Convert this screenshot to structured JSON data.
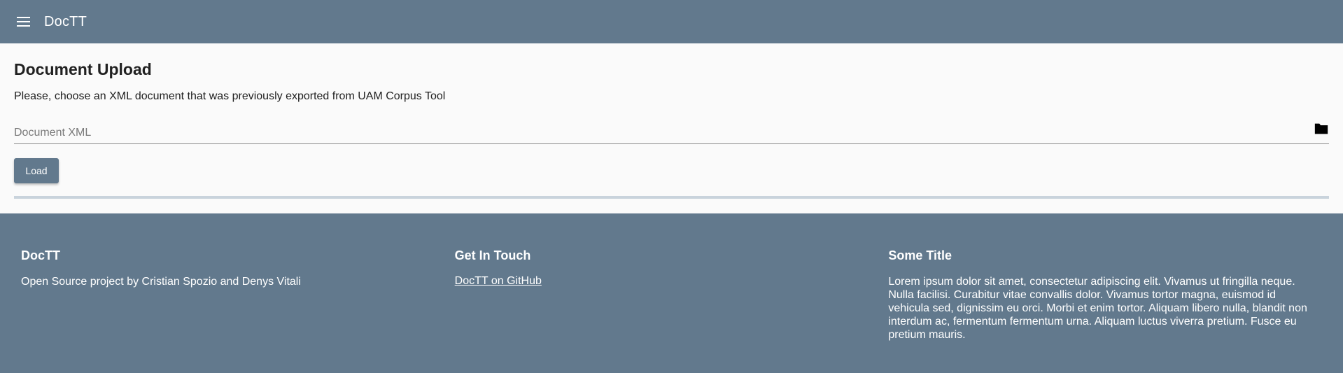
{
  "app": {
    "title": "DocTT"
  },
  "upload": {
    "title": "Document Upload",
    "instructions": "Please, choose an XML document that was previously exported from UAM Corpus Tool",
    "field_placeholder": "Document XML",
    "load_label": "Load"
  },
  "footer": {
    "col1": {
      "title": "DocTT",
      "text": "Open Source project by Cristian Spozio and Denys Vitali"
    },
    "col2": {
      "title": "Get In Touch",
      "link": "DocTT on GitHub"
    },
    "col3": {
      "title": "Some Title",
      "text": "Lorem ipsum dolor sit amet, consectetur adipiscing elit. Vivamus ut fringilla neque. Nulla facilisi. Curabitur vitae convallis dolor. Vivamus tortor magna, euismod id vehicula sed, dignissim eu orci. Morbi et enim tortor. Aliquam libero nulla, blandit non interdum ac, fermentum fermentum urna. Aliquam luctus viverra pretium. Fusce eu pretium mauris."
    }
  },
  "icons": {
    "menu": "menu-icon",
    "folder": "folder-icon"
  },
  "colors": {
    "primary": "#62798d",
    "progress_track": "#c9d3dc",
    "background": "#fafafa"
  }
}
